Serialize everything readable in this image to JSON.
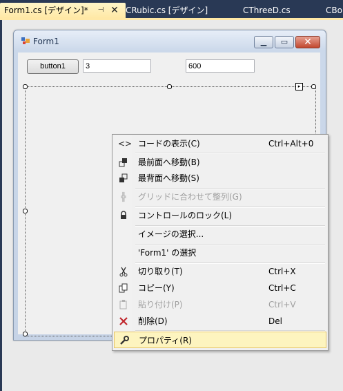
{
  "tabs": [
    {
      "label": "Form1.cs [デザイン]*",
      "active": true,
      "pin": "⊣",
      "close": "✕"
    },
    {
      "label": "CRubic.cs [デザイン]",
      "active": false
    },
    {
      "label": "CThreeD.cs",
      "active": false
    },
    {
      "label": "CBor",
      "active": false
    }
  ],
  "form": {
    "title": "Form1",
    "button_label": "button1",
    "textbox1_value": "3",
    "textbox2_value": "600"
  },
  "context_menu": {
    "items": [
      {
        "icon": "view-code-icon",
        "label": "コードの表示(C)",
        "shortcut": "Ctrl+Alt+0",
        "enabled": true
      },
      {
        "icon": "bring-to-front-icon",
        "label": "最前面へ移動(B)",
        "shortcut": "",
        "enabled": true
      },
      {
        "icon": "send-to-back-icon",
        "label": "最背面へ移動(S)",
        "shortcut": "",
        "enabled": true
      },
      {
        "icon": "align-to-grid-icon",
        "label": "グリッドに合わせて整列(G)",
        "shortcut": "",
        "enabled": false
      },
      {
        "icon": "lock-icon",
        "label": "コントロールのロック(L)",
        "shortcut": "",
        "enabled": true
      },
      {
        "icon": "",
        "label": "イメージの選択...",
        "shortcut": "",
        "enabled": true
      },
      {
        "icon": "",
        "label": "'Form1' の選択",
        "shortcut": "",
        "enabled": true
      },
      {
        "icon": "cut-icon",
        "label": "切り取り(T)",
        "shortcut": "Ctrl+X",
        "enabled": true
      },
      {
        "icon": "copy-icon",
        "label": "コピー(Y)",
        "shortcut": "Ctrl+C",
        "enabled": true
      },
      {
        "icon": "paste-icon",
        "label": "貼り付け(P)",
        "shortcut": "Ctrl+V",
        "enabled": false
      },
      {
        "icon": "delete-icon",
        "label": "削除(D)",
        "shortcut": "Del",
        "enabled": true
      },
      {
        "icon": "properties-icon",
        "label": "プロパティ(R)",
        "shortcut": "",
        "enabled": true,
        "highlighted": true
      }
    ]
  },
  "colors": {
    "ide_background": "#293955",
    "active_tab": "#ffe8a6",
    "menu_highlight": "#fdf4bf",
    "delete_icon": "#c0272d"
  }
}
